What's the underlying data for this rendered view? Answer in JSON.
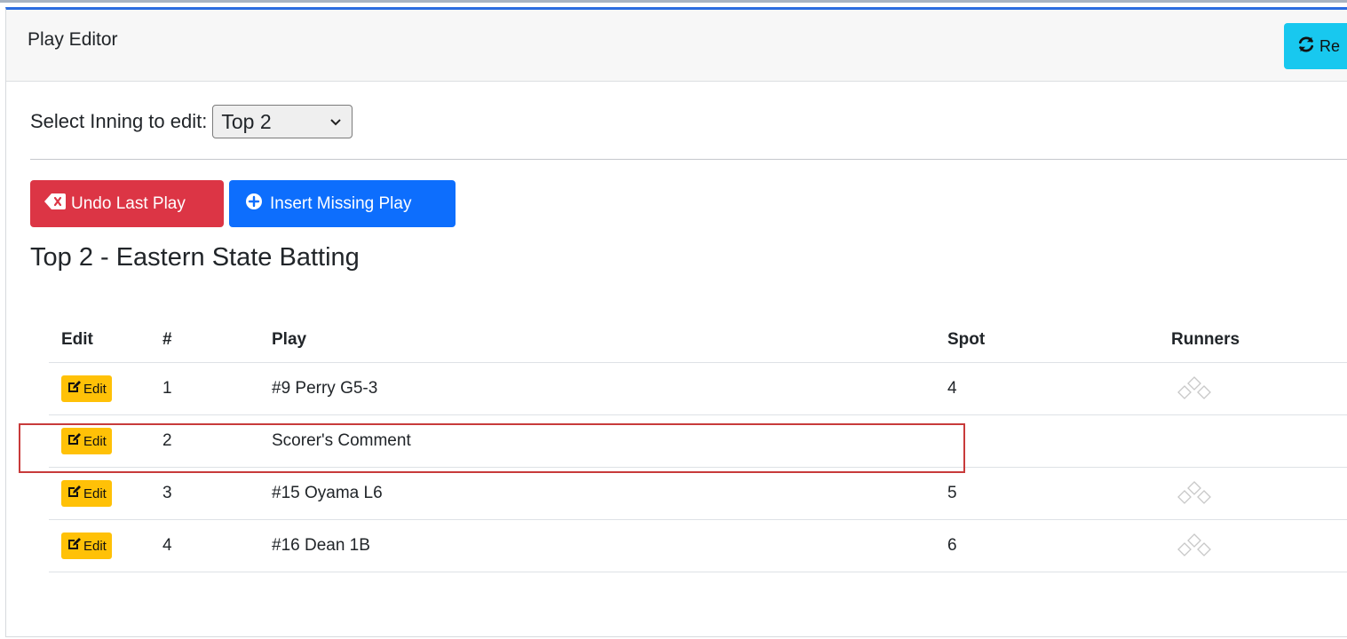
{
  "header": {
    "title": "Play Editor",
    "refresh_label": "Re"
  },
  "inning": {
    "label": "Select Inning to edit:",
    "selected": "Top 2"
  },
  "actions": {
    "undo_label": "Undo Last Play",
    "insert_label": "Insert Missing Play"
  },
  "section_title": "Top 2 - Eastern State Batting",
  "table": {
    "columns": [
      "Edit",
      "#",
      "Play",
      "Spot",
      "Runners"
    ],
    "edit_label": "Edit",
    "rows": [
      {
        "num": "1",
        "play": "#9 Perry G5-3",
        "spot": "4",
        "runners": true
      },
      {
        "num": "2",
        "play": "Scorer's Comment",
        "spot": "",
        "runners": false
      },
      {
        "num": "3",
        "play": "#15 Oyama L6",
        "spot": "5",
        "runners": true
      },
      {
        "num": "4",
        "play": "#16 Dean 1B",
        "spot": "6",
        "runners": true
      }
    ]
  },
  "colors": {
    "accent_top": "#2b6de0",
    "refresh": "#18c8ef",
    "undo": "#dc3545",
    "insert": "#0d6efd",
    "edit": "#ffc107",
    "highlight": "#c83b3b"
  }
}
